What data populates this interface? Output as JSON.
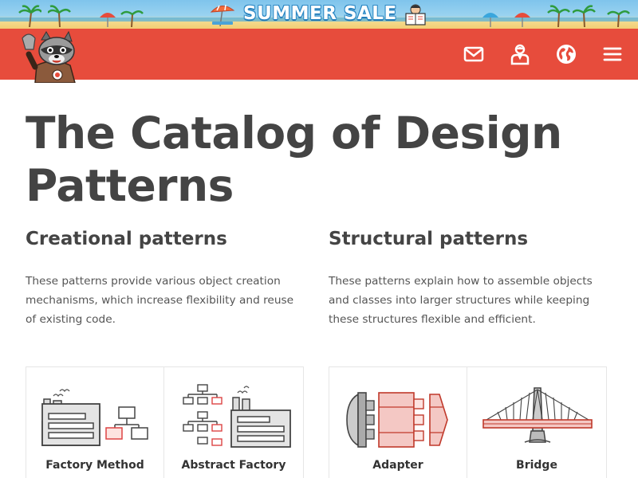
{
  "banner": {
    "title": "SUMMER SALE"
  },
  "header": {
    "icons": [
      "mail-icon",
      "account-icon",
      "globe-icon",
      "menu-icon"
    ]
  },
  "main": {
    "title": "The Catalog of Design Patterns",
    "sections": [
      {
        "heading": "Creational patterns",
        "description": "These patterns provide various object creation mechanisms, which increase flexibility and reuse of existing code.",
        "cards": [
          {
            "label": "Factory Method",
            "icon": "factory-method-icon"
          },
          {
            "label": "Abstract Factory",
            "icon": "abstract-factory-icon"
          }
        ]
      },
      {
        "heading": "Structural patterns",
        "description": "These patterns explain how to assemble objects and classes into larger structures while keeping these structures flexible and efficient.",
        "cards": [
          {
            "label": "Adapter",
            "icon": "adapter-icon"
          },
          {
            "label": "Bridge",
            "icon": "bridge-icon"
          }
        ]
      }
    ]
  },
  "colors": {
    "brand_red": "#e74c3c",
    "text_dark": "#444444",
    "sky": "#8ccdf0",
    "sand": "#f2cd74"
  }
}
